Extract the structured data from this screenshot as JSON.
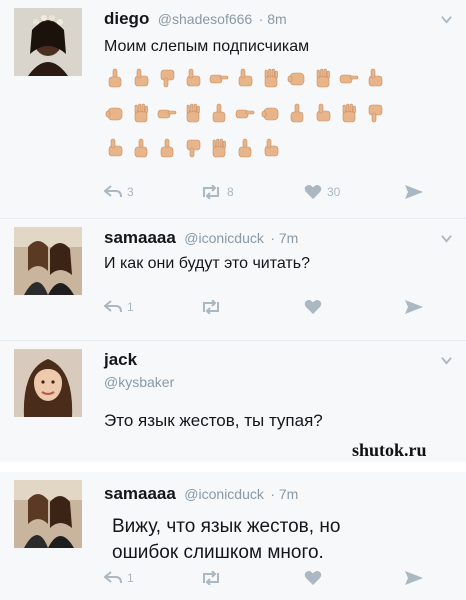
{
  "tweets": [
    {
      "display_name": "diego",
      "handle": "@shadesof666",
      "time": "· 8m",
      "text": "Моим слепым подписчикам",
      "reply_count": "3",
      "retweet_count": "8",
      "like_count": "30"
    },
    {
      "display_name": "samaaaa",
      "handle": "@iconicduck",
      "time": "· 7m",
      "text": "И как они будут это читать?",
      "reply_count": "1",
      "retweet_count": "",
      "like_count": ""
    },
    {
      "display_name": "jack",
      "handle": "@kysbaker",
      "time": "",
      "text": "Это язык жестов, ты тупая?",
      "reply_count": "",
      "retweet_count": "",
      "like_count": ""
    },
    {
      "display_name": "samaaaa",
      "handle": "@iconicduck",
      "time": "· 7m",
      "text_line1": "Вижу, что язык жестов, но",
      "text_line2": "ошибок слишком много.",
      "reply_count": "1",
      "retweet_count": "",
      "like_count": ""
    }
  ],
  "watermark": "shutok.ru",
  "colors": {
    "skin": "#e8b48a",
    "skin_shade": "#c98e62",
    "action_gray": "#aab8c2",
    "handle_gray": "#8899a6"
  },
  "icons": {
    "reply": "reply-icon",
    "retweet": "retweet-icon",
    "like": "heart-icon",
    "dm": "direct-message-icon",
    "more": "chevron-down-icon"
  }
}
